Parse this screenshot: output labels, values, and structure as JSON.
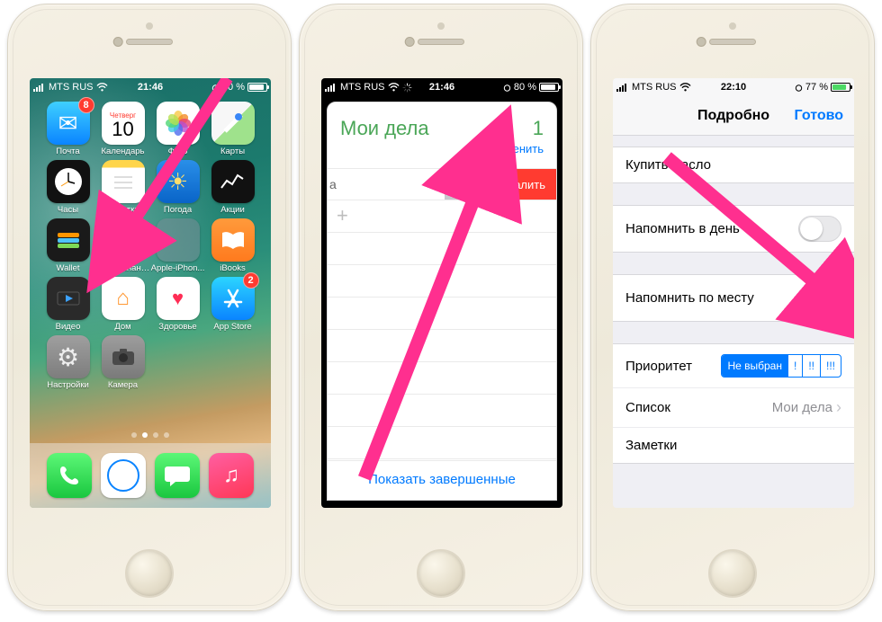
{
  "status": {
    "carrier": "MTS RUS",
    "time1": "21:46",
    "time2": "21:46",
    "time3": "22:10",
    "battery1": "80 %",
    "battery2": "80 %",
    "battery3": "77 %"
  },
  "home": {
    "calendar": {
      "weekday": "Четверг",
      "day": "10"
    },
    "apps": {
      "mail": "Почта",
      "calendar": "Календарь",
      "photos": "Фото",
      "maps": "Карты",
      "clock": "Часы",
      "notes": "Заметки",
      "weather": "Погода",
      "stocks": "Акции",
      "wallet": "Wallet",
      "reminders": "Напоминания",
      "folder": "Apple-iPhon...",
      "ibooks": "iBooks",
      "videos": "Видео",
      "homeapp": "Дом",
      "health": "Здоровье",
      "appstore": "App Store",
      "settings": "Настройки",
      "camera": "Камера"
    },
    "badges": {
      "mail": "8",
      "appstore": "2"
    }
  },
  "reminders": {
    "title": "Мои дела",
    "count": "1",
    "edit": "Изменить",
    "more": "Еще",
    "delete": "Удалить",
    "showCompleted": "Показать завершенные"
  },
  "details": {
    "navTitle": "Подробно",
    "done": "Готово",
    "itemTitle": "Купить масло",
    "remindDay": "Напомнить в день",
    "remindLoc": "Напомнить по месту",
    "priority": "Приоритет",
    "priority_none": "Не выбран",
    "priority_1": "!",
    "priority_2": "!!",
    "priority_3": "!!!",
    "list": "Список",
    "listValue": "Мои дела",
    "notes": "Заметки"
  }
}
